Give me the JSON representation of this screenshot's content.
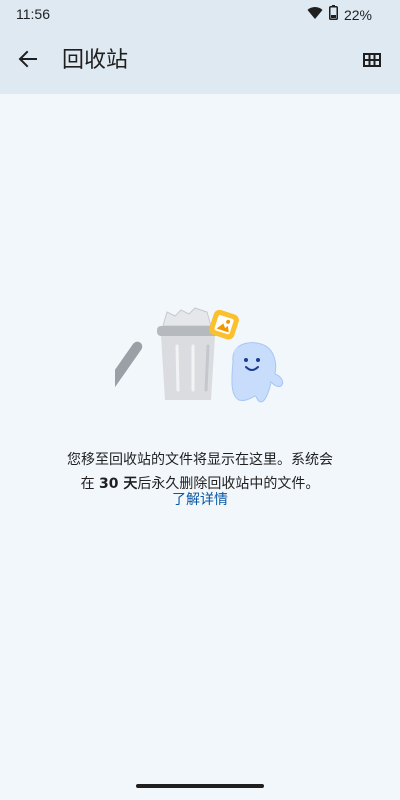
{
  "status_bar": {
    "time": "11:56",
    "battery": "22%",
    "icons": [
      "wifi-icon",
      "battery-icon"
    ]
  },
  "app_bar": {
    "title": "回收站",
    "back_icon": "arrow-back-icon",
    "view_icon": "grid-view-icon"
  },
  "empty_state": {
    "illustration": "trash-can-with-character-illustration",
    "line1": "您移至回收站的文件将显示在这里。系统会",
    "line2_prefix": "在 ",
    "days": "30 天",
    "line2_suffix": "后永久删除回收站中的文件。",
    "learn_more": "了解详情"
  },
  "colors": {
    "background": "#f2f7fc",
    "app_bar": "#dfe9f2",
    "link": "#0b57a5"
  }
}
